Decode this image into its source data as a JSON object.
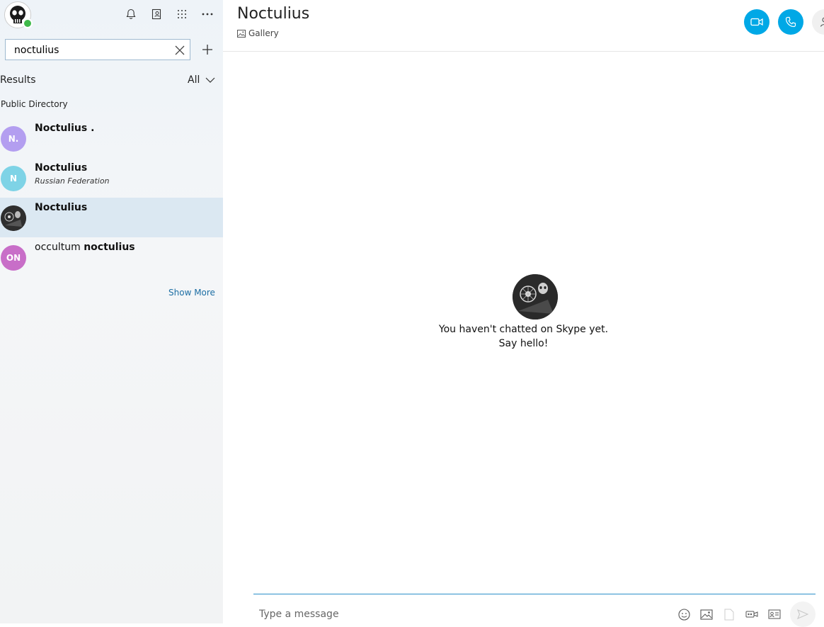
{
  "sidebar": {
    "search": {
      "value": "noctulius",
      "placeholder": ""
    },
    "results_label": "Results",
    "filter_label": "All",
    "section_title": "Public Directory",
    "results": [
      {
        "initials": "N.",
        "avatar_color": "#b39ef0",
        "name": "Noctulius .",
        "subtitle": ""
      },
      {
        "initials": "N",
        "avatar_color": "#7ed3e6",
        "name": "Noctulius",
        "subtitle": "Russian Federation"
      },
      {
        "initials": "",
        "avatar_color": "#2a2a2a",
        "name": "Noctulius",
        "subtitle": ""
      },
      {
        "initials": "ON",
        "avatar_color": "#c86ec8",
        "name_prefix": "occultum ",
        "name": "noctulius",
        "subtitle": ""
      }
    ],
    "show_more": "Show More"
  },
  "main": {
    "title": "Noctulius",
    "gallery_label": "Gallery",
    "empty_line1": "You haven't chatted on Skype yet.",
    "empty_line2": "Say hello!",
    "compose_placeholder": "Type a message"
  },
  "colors": {
    "accent": "#00a8e6",
    "selected_row": "#dbe8f2",
    "link": "#1c6ea4",
    "presence_online": "#3fb94a"
  }
}
